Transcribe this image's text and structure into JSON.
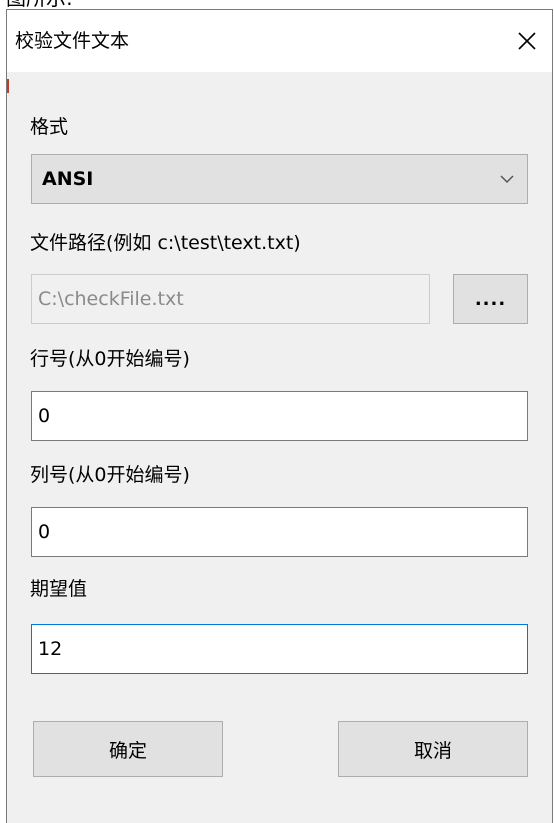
{
  "top_caption": "图所示:",
  "dialog": {
    "title": "校验文件文本",
    "close_icon": "close-icon"
  },
  "format": {
    "label": "格式",
    "selected": "ANSI",
    "dropdown_icon": "chevron-down-icon"
  },
  "file_path": {
    "label": "文件路径(例如 c:\\test\\text.txt)",
    "value": "C:\\checkFile.txt",
    "browse_label": "...."
  },
  "line_number": {
    "label": "行号(从0开始编号)",
    "value": "0"
  },
  "column_number": {
    "label": "列号(从0开始编号)",
    "value": "0"
  },
  "expected_value": {
    "label": "期望值",
    "value": "12"
  },
  "buttons": {
    "ok": "确定",
    "cancel": "取消"
  },
  "colors": {
    "focus_border": "#0078d7",
    "dialog_bg": "#f0f0f0"
  }
}
